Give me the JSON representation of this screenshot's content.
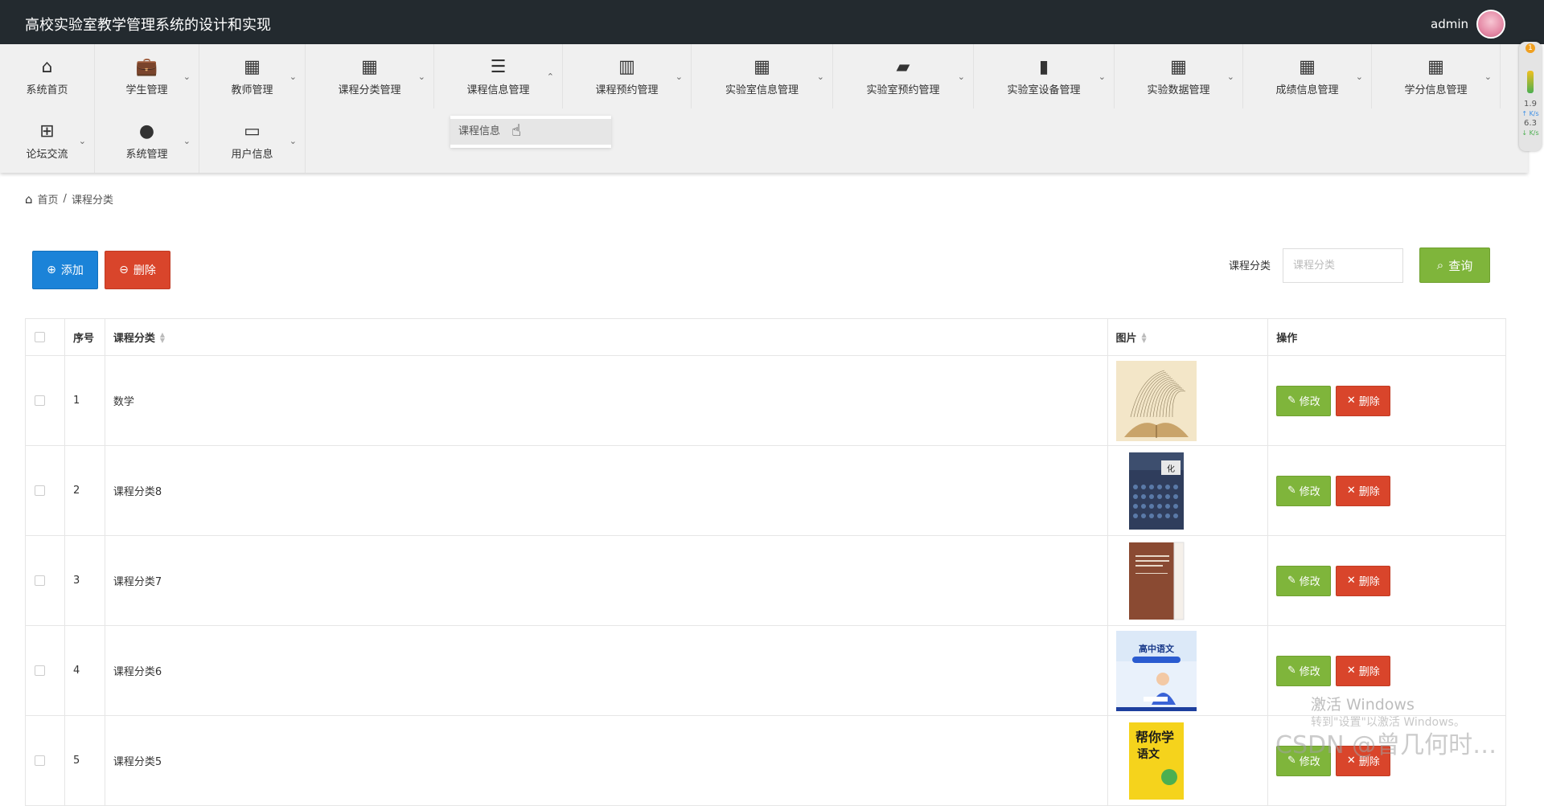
{
  "header": {
    "title": "高校实验室教学管理系统的设计和实现",
    "username": "admin"
  },
  "nav": {
    "row1": [
      {
        "label": "系统首页",
        "icon": "home-icon",
        "glyph": "⌂"
      },
      {
        "label": "学生管理",
        "icon": "briefcase-icon",
        "glyph": "💼"
      },
      {
        "label": "教师管理",
        "icon": "grid-icon",
        "glyph": "▦"
      },
      {
        "label": "课程分类管理",
        "icon": "grid-icon",
        "glyph": "▦"
      },
      {
        "label": "课程信息管理",
        "icon": "list-icon",
        "glyph": "☰"
      },
      {
        "label": "课程预约管理",
        "icon": "books-icon",
        "glyph": "▥"
      },
      {
        "label": "实验室信息管理",
        "icon": "grid-icon",
        "glyph": "▦"
      },
      {
        "label": "实验室预约管理",
        "icon": "ticket-icon",
        "glyph": "▰"
      },
      {
        "label": "实验室设备管理",
        "icon": "bar-chart-icon",
        "glyph": "▮"
      },
      {
        "label": "实验数据管理",
        "icon": "grid-icon",
        "glyph": "▦"
      },
      {
        "label": "成绩信息管理",
        "icon": "grid-icon",
        "glyph": "▦"
      },
      {
        "label": "学分信息管理",
        "icon": "grid-icon",
        "glyph": "▦"
      }
    ],
    "row2": [
      {
        "label": "论坛交流",
        "icon": "apps-icon",
        "glyph": "⊞"
      },
      {
        "label": "系统管理",
        "icon": "user-icon",
        "glyph": "●"
      },
      {
        "label": "用户信息",
        "icon": "card-icon",
        "glyph": "▭"
      }
    ],
    "dropdown_item": "课程信息"
  },
  "breadcrumb": {
    "home": "首页",
    "separator": "/",
    "current": "课程分类"
  },
  "toolbar": {
    "add_label": "添加",
    "delete_label": "删除"
  },
  "search": {
    "label": "课程分类",
    "placeholder": "课程分类",
    "button_label": "查询"
  },
  "table": {
    "headers": {
      "no": "序号",
      "category": "课程分类",
      "image": "图片",
      "action": "操作"
    },
    "rows": [
      {
        "no": "1",
        "category": "数学",
        "image": "open-book"
      },
      {
        "no": "2",
        "category": "课程分类8",
        "image": "chemistry-book"
      },
      {
        "no": "3",
        "category": "课程分类7",
        "image": "chinese-standard-book"
      },
      {
        "no": "4",
        "category": "课程分类6",
        "image": "high-school-chinese"
      },
      {
        "no": "5",
        "category": "课程分类5",
        "image": "yellow-chinese-book"
      }
    ],
    "edit_label": "修改",
    "delete_label": "删除"
  },
  "overlay": {
    "activate_windows": "激活 Windows",
    "activate_hint": "转到\"设置\"以激活 Windows。",
    "csdn": "CSDN @曾几何时…",
    "gauge_badge": "1",
    "gauge_up": "1.9",
    "gauge_up_unit": "K/s",
    "gauge_down": "6.3",
    "gauge_down_unit": "K/s"
  },
  "colors": {
    "topbar": "#232a2f",
    "primary": "#1b83d8",
    "danger": "#d9452b",
    "success": "#7fb53b"
  }
}
